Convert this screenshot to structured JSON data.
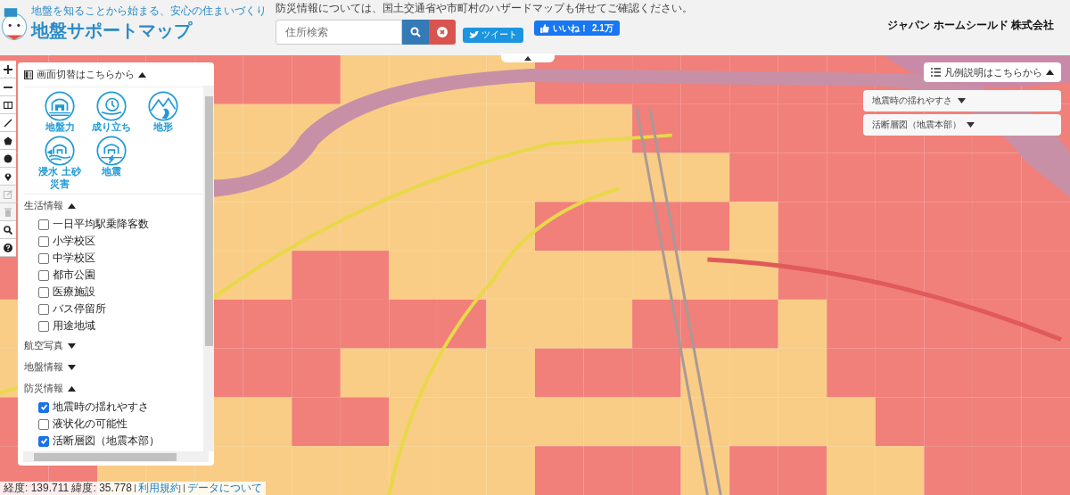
{
  "header": {
    "tagline": "地盤を知ることから始まる、安心の住まいづくり",
    "title": "地盤サポートマップ",
    "notice": "防災情報については、国土交通省や市町村のハザードマップも併せてご確認ください。",
    "search": {
      "placeholder": "住所検索"
    },
    "tweet": "ツイート",
    "like": {
      "label": "いいね！",
      "count": "2.1万"
    },
    "company": "ジャパン ホームシールド 株式会社"
  },
  "map_tools": [
    {
      "kind": "zoom-in",
      "disabled": false
    },
    {
      "kind": "zoom-out",
      "disabled": false
    },
    {
      "kind": "panel",
      "disabled": false
    },
    {
      "kind": "line",
      "disabled": false
    },
    {
      "kind": "polygon",
      "disabled": false
    },
    {
      "kind": "circle",
      "disabled": false
    },
    {
      "kind": "marker",
      "disabled": false
    },
    {
      "kind": "edit",
      "disabled": true
    },
    {
      "kind": "delete",
      "disabled": true
    },
    {
      "kind": "search",
      "disabled": false
    },
    {
      "kind": "help",
      "disabled": false
    }
  ],
  "panel": {
    "title": "画面切替はこちらから",
    "expanded": true,
    "categories": [
      {
        "kind": "foundation",
        "label": "地盤力"
      },
      {
        "kind": "history",
        "label": "成り立ち"
      },
      {
        "kind": "terrain",
        "label": "地形"
      },
      {
        "kind": "flood",
        "label": "浸水 土砂災害"
      },
      {
        "kind": "quake",
        "label": "地震"
      }
    ],
    "sections": [
      {
        "label": "生活情報",
        "expanded": true,
        "items": [
          {
            "label": "一日平均駅乗降客数",
            "checked": false
          },
          {
            "label": "小学校区",
            "checked": false
          },
          {
            "label": "中学校区",
            "checked": false
          },
          {
            "label": "都市公園",
            "checked": false
          },
          {
            "label": "医療施設",
            "checked": false
          },
          {
            "label": "バス停留所",
            "checked": false
          },
          {
            "label": "用途地域",
            "checked": false
          }
        ]
      },
      {
        "label": "航空写真",
        "expanded": false
      },
      {
        "label": "地盤情報",
        "expanded": false
      },
      {
        "label": "防災情報",
        "expanded": true,
        "items": [
          {
            "label": "地震時の揺れやすさ",
            "checked": true
          },
          {
            "label": "液状化の可能性",
            "checked": false
          },
          {
            "label": "活断層図（地震本部）",
            "checked": true
          }
        ]
      }
    ]
  },
  "legend": {
    "label": "凡例説明はこちらから",
    "expanded": true,
    "dropdowns": [
      {
        "label": "地震時の揺れやすさ"
      },
      {
        "label": "活断層図（地震本部）"
      }
    ]
  },
  "status": {
    "coords": "経度: 139.711 緯度: 35.778",
    "links": [
      "利用規約",
      "データについて"
    ]
  }
}
